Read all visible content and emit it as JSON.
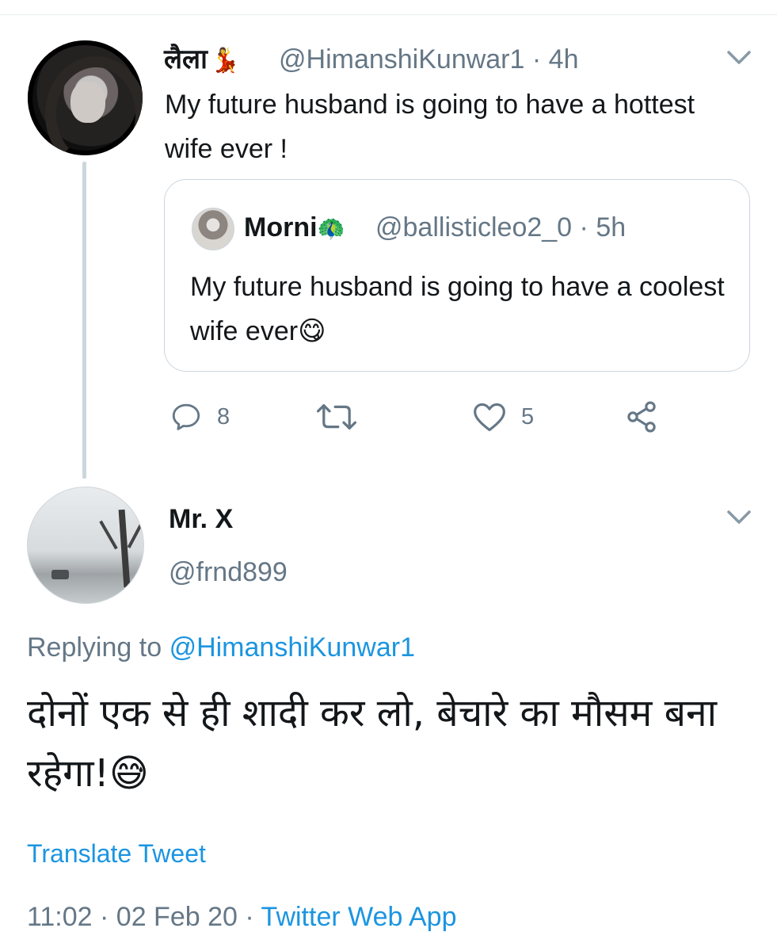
{
  "original_tweet": {
    "display_name": "लैला",
    "name_emoji": "💃",
    "handle": "@HimanshiKunwar1",
    "separator": "·",
    "time": "4h",
    "text": "My future husband is going to have a hottest wife ever !",
    "quoted": {
      "display_name": "Morni",
      "name_emoji": "🦚",
      "handle": "@ballisticleo2_0",
      "separator": "·",
      "time": "5h",
      "text": "My future husband is going to have a coolest wife ever",
      "text_emoji": "😋"
    },
    "actions": {
      "replies": "8",
      "retweets": "",
      "likes": "5"
    }
  },
  "reply_tweet": {
    "display_name": "Mr. X",
    "handle": "@frnd899",
    "replying_prefix": "Replying to",
    "replying_to": "@HimanshiKunwar1",
    "text": "दोनों एक से ही शादी कर लो, बेचारे का मौसम बना रहेगा!",
    "text_emoji": "😅",
    "translate_label": "Translate Tweet",
    "time": "11:02",
    "dot1": "·",
    "date": "02 Feb 20",
    "dot2": "·",
    "source": "Twitter Web App"
  },
  "icons": [
    "chevron-down-icon",
    "reply-icon",
    "retweet-icon",
    "like-icon",
    "share-icon"
  ],
  "colors": {
    "link": "#1b95e0",
    "muted": "#657786",
    "thread_line": "#ccd6dd",
    "border": "#ccd6dd"
  }
}
